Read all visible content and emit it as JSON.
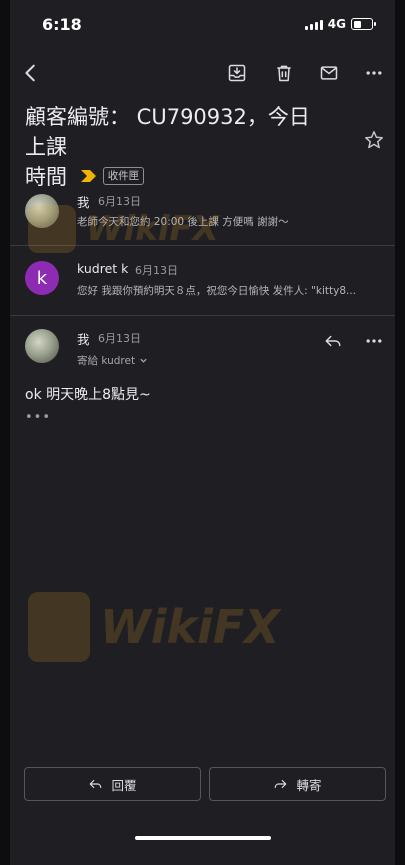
{
  "status_bar": {
    "time": "6:18",
    "network": "4G"
  },
  "toolbar": {
    "back_icon": "chevron-left-icon",
    "archive_icon": "archive-icon",
    "delete_icon": "trash-icon",
    "mark_unread_icon": "mail-icon",
    "more_icon": "more-horizontal-icon"
  },
  "subject": {
    "line1": "顧客編號： CU790932，今日上課",
    "line2": "時間",
    "label": "收件匣"
  },
  "messages": [
    {
      "sender": "我",
      "date": "6月13日",
      "snippet": "老師今天和您約 20:00 後上課 方便嗎 謝謝～"
    },
    {
      "sender": "kudret k",
      "avatar_letter": "k",
      "date": "6月13日",
      "snippet": "您好 我跟你預約明天８点，祝您今日愉快 发件人: \"kitty8..."
    },
    {
      "sender": "我",
      "date": "6月13日",
      "recipient": "寄給 kudret",
      "body": "ok 明天晚上8點見~",
      "ellipsis": "•••"
    }
  ],
  "watermark": "WikiFX",
  "actions": {
    "reply": "回覆",
    "forward": "轉寄"
  },
  "colors": {
    "background": "#1f1f23",
    "accent_label": "#f2b308",
    "avatar_k": "#8e2bb3"
  }
}
